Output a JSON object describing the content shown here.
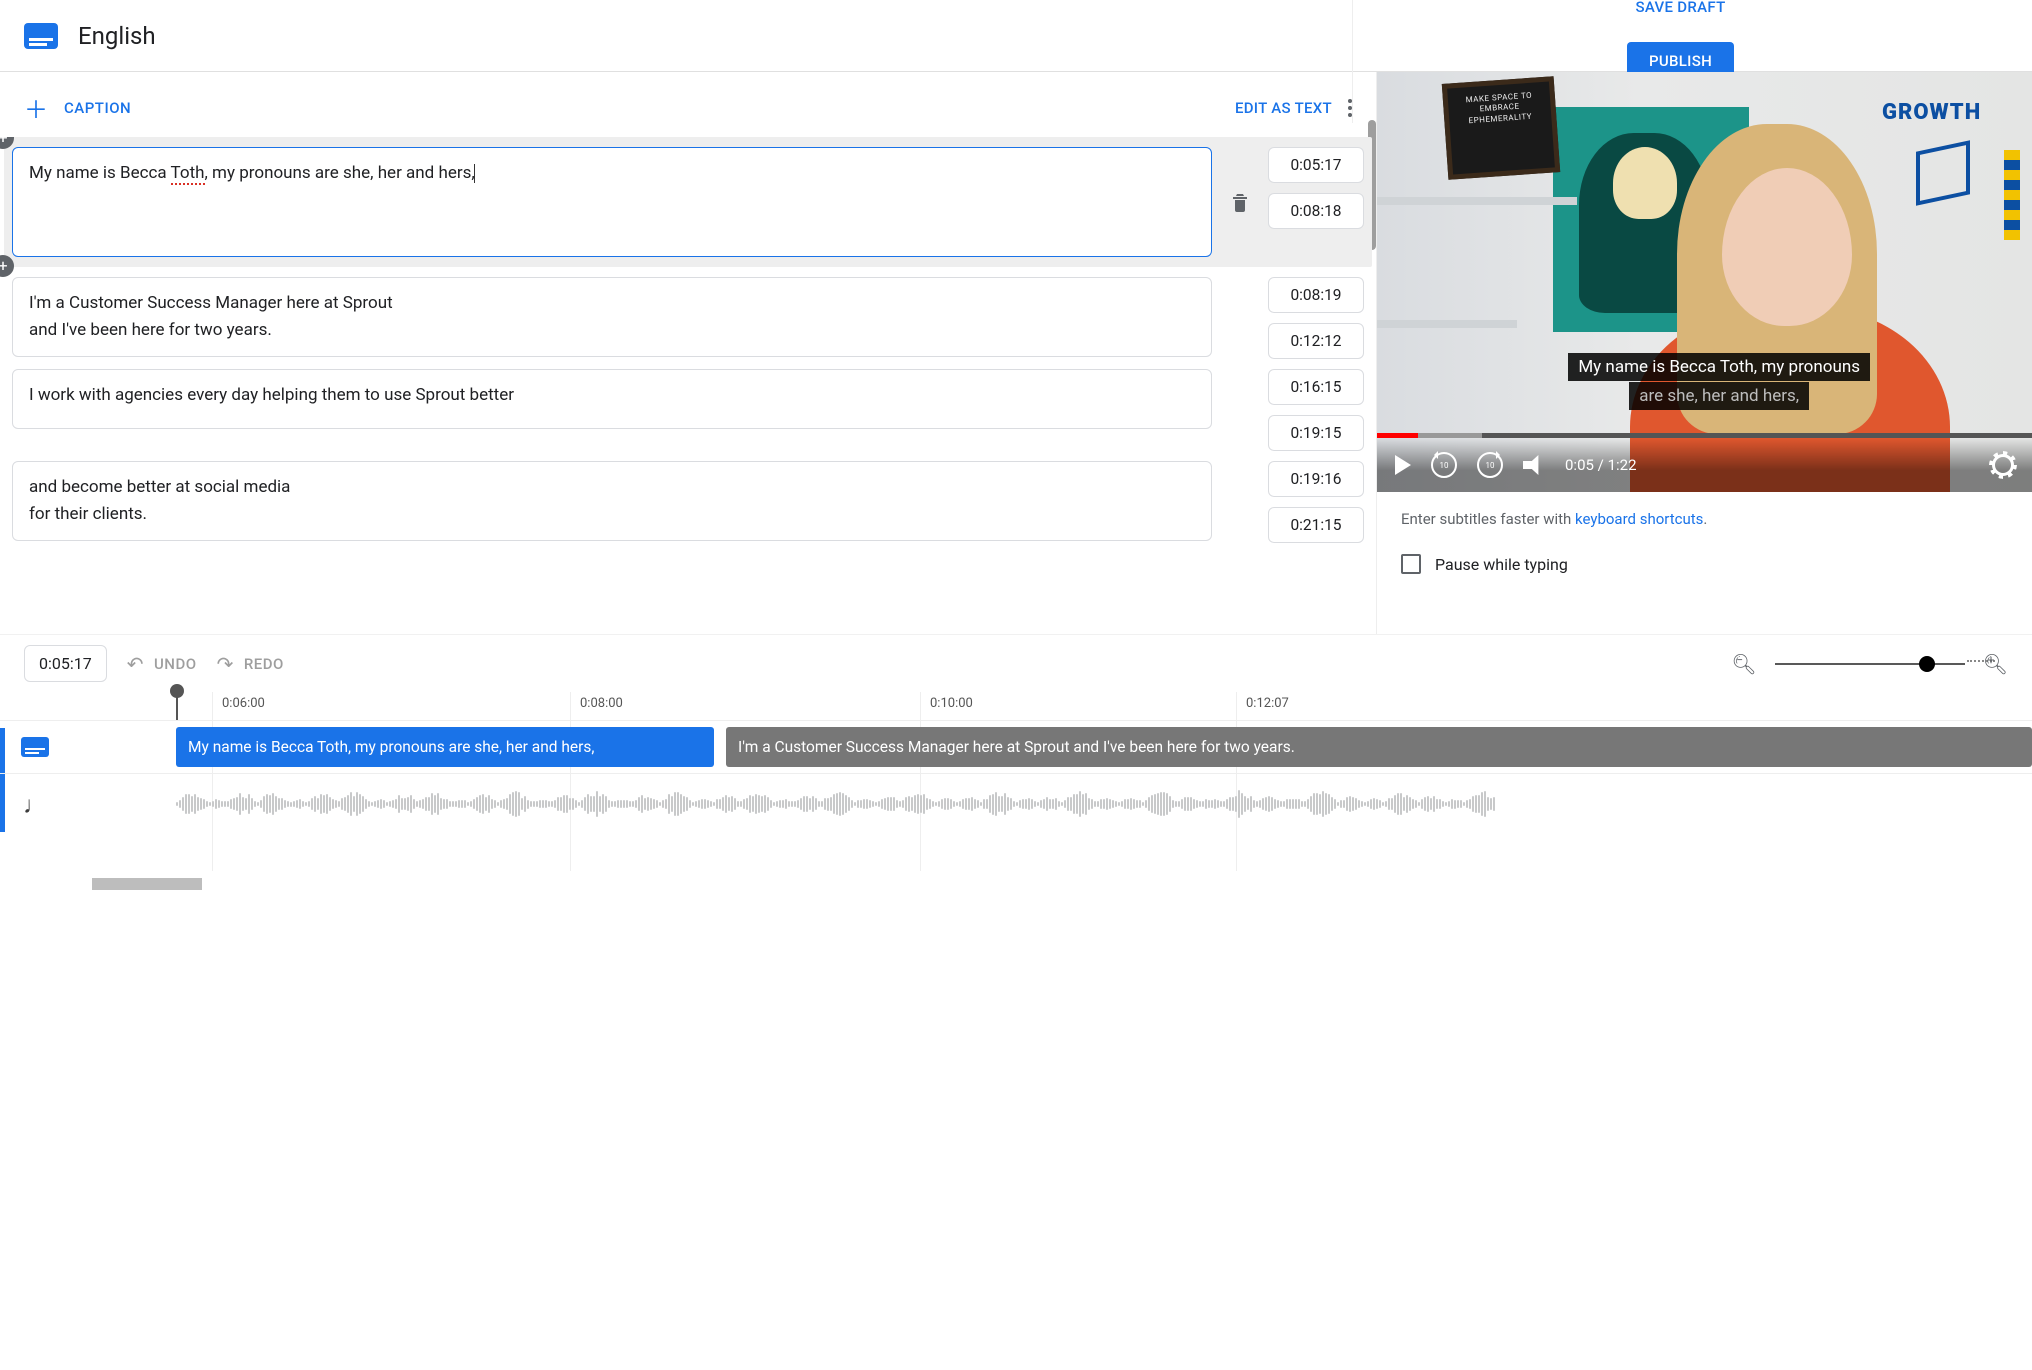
{
  "header": {
    "language": "English",
    "save_draft": "SAVE DRAFT",
    "publish": "PUBLISH"
  },
  "toolbar": {
    "add_caption": "CAPTION",
    "edit_as_text": "EDIT AS TEXT"
  },
  "captions": [
    {
      "text_prefix": "My name is Becca ",
      "spell": "Toth",
      "text_suffix": ", my pronouns are she, her and hers,",
      "line2": "",
      "start": "0:05:17",
      "end": "0:08:18",
      "active": true
    },
    {
      "text": "I'm a Customer Success Manager here at Sprout",
      "line2": "and I've been here for two years.",
      "start": "0:08:19",
      "end": "0:12:12",
      "active": false
    },
    {
      "text": "I work with agencies every day helping them to use Sprout better",
      "line2": "",
      "start": "0:16:15",
      "end": "0:19:15",
      "active": false
    },
    {
      "text": "and become better at social media",
      "line2": "for their clients.",
      "start": "0:19:16",
      "end": "0:21:15",
      "active": false
    }
  ],
  "video": {
    "board_text": "MAKE SPACE TO EMBRACE EPHEMERALITY",
    "growth_text": "GROWTH",
    "subtitle_line1": "My name is Becca Toth, my pronouns",
    "subtitle_line2": "are she, her and hers,",
    "current_time": "0:05",
    "duration": "1:22",
    "replay_num": "10",
    "forward_num": "10"
  },
  "hints": {
    "tip_prefix": "Enter subtitles faster with ",
    "shortcuts_link": "keyboard shortcuts",
    "pause_label": "Pause while typing"
  },
  "tl": {
    "current": "0:05:17",
    "undo": "UNDO",
    "redo": "REDO",
    "ticks": [
      "0:06:00",
      "0:08:00",
      "0:10:00",
      "0:12:07"
    ],
    "seg_active": "My name is Becca Toth, my pronouns are she, her and hers,",
    "seg_next": "I'm a Customer Success Manager here at Sprout and I've been here for two years."
  }
}
